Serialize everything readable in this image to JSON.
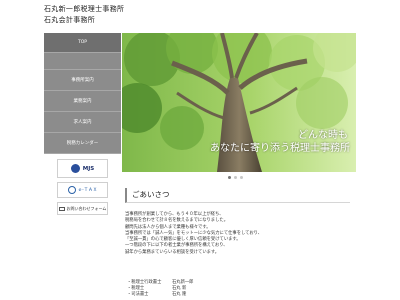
{
  "header": {
    "line1": "石丸新一郎税理士事務所",
    "line2": "石丸会計事務所"
  },
  "nav": {
    "items": [
      {
        "label": "TOP"
      },
      {
        "label": "事務所案内"
      },
      {
        "label": "業務案内"
      },
      {
        "label": "求人案内"
      },
      {
        "label": "税務カレンダー"
      }
    ]
  },
  "banners": {
    "mjs": "MJS",
    "tax": "ｅ-ＴＡＸ",
    "form": "お問い合わせフォーム"
  },
  "hero": {
    "line1": "どんな時も",
    "line2": "あなたに寄り添う税理士事務所"
  },
  "slider": {
    "count": 3,
    "active": 0
  },
  "greeting": {
    "title": "ごあいさつ",
    "paragraphs": [
      "当事務所が創業してから、もう４０年以上が経ち、",
      "税務局を合わせて計８名を数えるまでになりました。",
      "顧問先は法人から個人まで業種も様々です。",
      "当事務所では「誠人一気」をモットーに少な気力にて仕事をしており、",
      "「至誠一貫」の心で顧客に優しく厚い信頼を受けています。",
      "一つ階段の下に以下の者士業が事務所を構えており、",
      "誠年から業務まていらいる相談を受けています。"
    ],
    "staff": [
      {
        "role": "・税理士行政書士",
        "name": "石丸新一郎"
      },
      {
        "role": "・税理士",
        "name": "石丸 新"
      },
      {
        "role": "・司法書士",
        "name": "石丸 隆"
      }
    ]
  },
  "colors": {
    "nav_bg": "#8c8c8c",
    "nav_active": "#6f6f6f",
    "accent_blue": "#2b62a8"
  }
}
